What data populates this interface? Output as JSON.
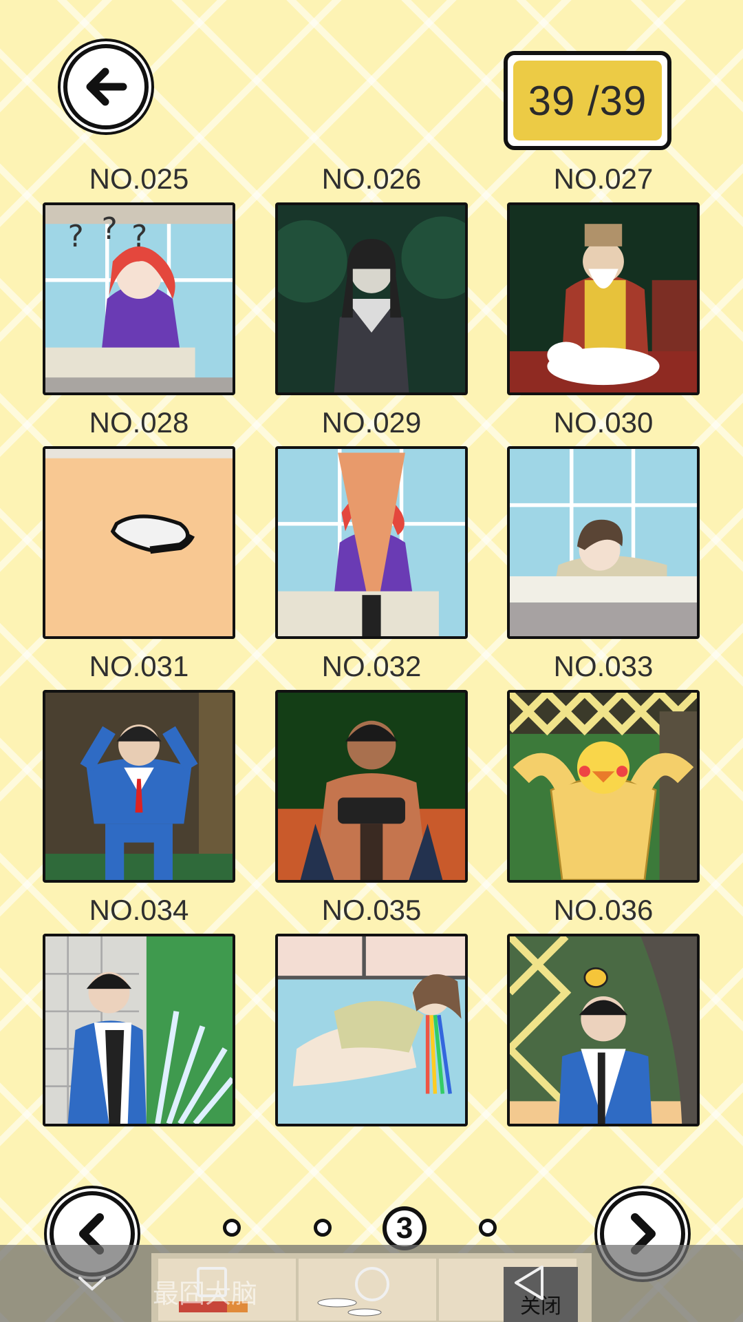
{
  "header": {
    "back_icon": "arrow-left-icon",
    "counter_text": "39 /39"
  },
  "grid": {
    "items": [
      {
        "label": "NO.025"
      },
      {
        "label": "NO.026"
      },
      {
        "label": "NO.027"
      },
      {
        "label": "NO.028"
      },
      {
        "label": "NO.029"
      },
      {
        "label": "NO.030"
      },
      {
        "label": "NO.031"
      },
      {
        "label": "NO.032"
      },
      {
        "label": "NO.033"
      },
      {
        "label": "NO.034"
      },
      {
        "label": "NO.035"
      },
      {
        "label": "NO.036"
      }
    ]
  },
  "pagination": {
    "prev_icon": "chevron-left-icon",
    "next_icon": "chevron-right-icon",
    "current_page": "3",
    "pages": 4
  },
  "ad": {
    "text": "最囧大脑",
    "close_label": "关闭"
  },
  "system_nav": {
    "collapse_icon": "chevron-down-icon",
    "recents_icon": "square-icon",
    "home_icon": "circle-icon",
    "back_icon": "triangle-back-icon"
  },
  "colors": {
    "background": "#fdf3b4",
    "counter_fill": "#eccb45",
    "outline": "#111111"
  }
}
